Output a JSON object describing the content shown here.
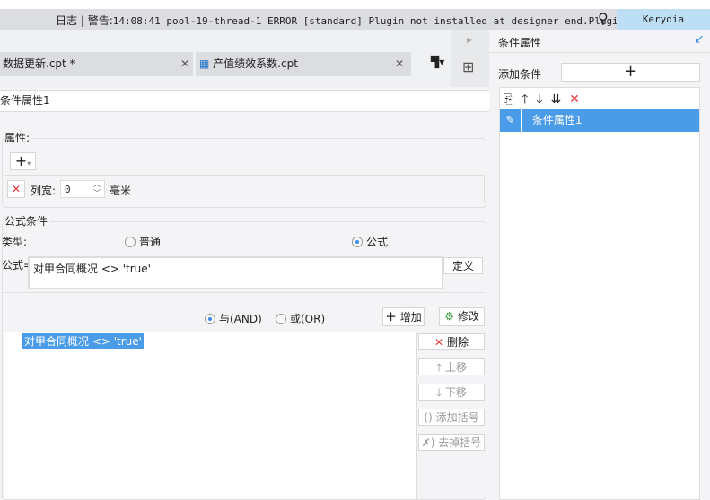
{
  "status": {
    "log_label": "日志",
    "separator": "|",
    "warning_label": "警告:",
    "message": "14:08:41 pool-19-thread-1 ERROR [standard] Plugin not installed at designer end.Plugi...",
    "user": "Kerydia"
  },
  "tabs": [
    {
      "label": "数据更新.cpt *"
    },
    {
      "label": "产值绩效系数.cpt"
    }
  ],
  "editor": {
    "title": "条件属性1",
    "attributes": {
      "legend": "属性:",
      "column_width_label": "列宽:",
      "column_width_value": "0",
      "unit": "毫米"
    },
    "formula_condition": {
      "legend": "公式条件",
      "type_label": "类型:",
      "type_options": [
        "普通",
        "公式"
      ],
      "type_selected": "公式",
      "formula_label": "公式=",
      "formula_value": "对甲合同概况 <> 'true'",
      "define_button": "定义"
    },
    "logic": {
      "and_label": "与(AND)",
      "or_label": "或(OR)",
      "selected": "AND",
      "add_button": "增加",
      "modify_button": "修改"
    },
    "conditions": [
      "对甲合同概况 <> 'true'"
    ],
    "actions": {
      "delete": "删除",
      "move_up": "上移",
      "move_down": "下移",
      "add_bracket": "添加括号",
      "remove_bracket": "去掉括号"
    }
  },
  "right_panel": {
    "title": "条件属性",
    "add_condition_label": "添加条件",
    "add_symbol": "+",
    "items": [
      "条件属性1"
    ]
  }
}
